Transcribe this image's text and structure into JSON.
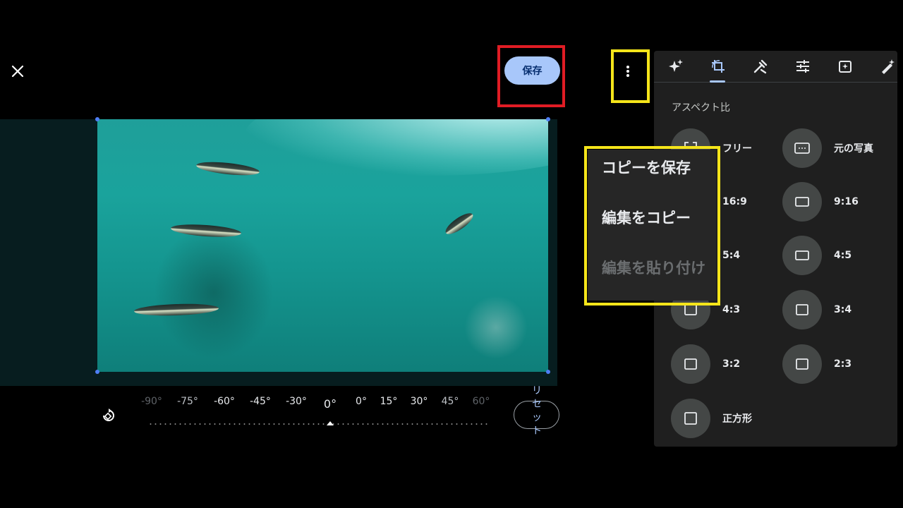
{
  "header": {
    "save_label": "保存"
  },
  "straighten": {
    "ticks": [
      "-90°",
      "-75°",
      "-60°",
      "-45°",
      "-30°",
      "0°",
      "0°",
      "15°",
      "30°",
      "45°",
      "60°"
    ],
    "current_label": "0°",
    "reset_label": "リセット"
  },
  "panel": {
    "tools": [
      "auto-enhance-icon",
      "crop-rotate-icon",
      "tools-icon",
      "adjust-icon",
      "add-frame-icon",
      "markup-icon"
    ],
    "active_tool": "crop-rotate-icon",
    "section_title": "アスペクト比",
    "aspect_ratios": [
      {
        "label": "フリー"
      },
      {
        "label": "元の写真"
      },
      {
        "label": "16:9"
      },
      {
        "label": "9:16"
      },
      {
        "label": "5:4"
      },
      {
        "label": "4:5"
      },
      {
        "label": "4:3"
      },
      {
        "label": "3:4"
      },
      {
        "label": "3:2"
      },
      {
        "label": "2:3"
      },
      {
        "label": "正方形"
      }
    ]
  },
  "menu": {
    "items": [
      {
        "label": "コピーを保存",
        "enabled": true
      },
      {
        "label": "編集をコピー",
        "enabled": true
      },
      {
        "label": "編集を貼り付け",
        "enabled": false
      }
    ]
  },
  "colors": {
    "accent": "#a8c7fa",
    "highlight_red": "#e01c24",
    "highlight_yellow": "#f5e51a",
    "panel_bg": "#1f1f1f"
  }
}
